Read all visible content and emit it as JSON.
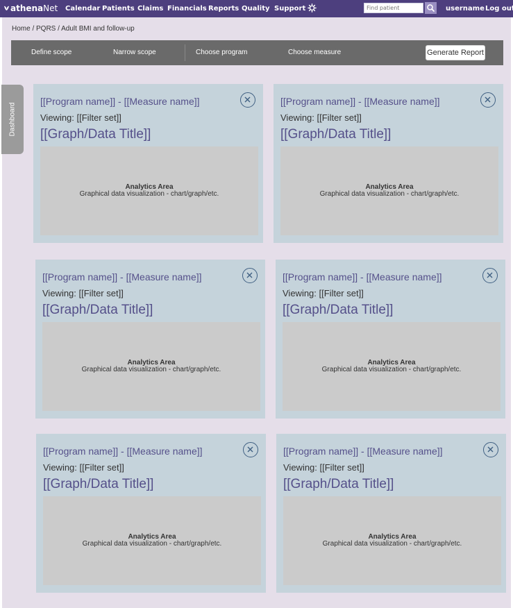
{
  "nav": {
    "logo_bold": "athena",
    "logo_light": "Net",
    "items": [
      "Calendar",
      "Patients",
      "Claims",
      "Financials",
      "Reports",
      "Quality",
      "Support"
    ],
    "search_placeholder": "Find patient",
    "username": "username",
    "logout": "Log out",
    "icons": [
      "leaf-icon",
      "gear-icon",
      "search-icon"
    ]
  },
  "breadcrumb": "Home  /  PQRS  / Adult BMI and follow-up",
  "toolbar": {
    "steps": [
      "Define scope",
      "Narrow scope",
      "Choose program",
      "Choose measure"
    ],
    "generate_label": "Generate Report"
  },
  "sidebar": {
    "dashboard_label": "Dashboard"
  },
  "cards": [
    {
      "title": "[[Program name]] - [[Measure name]]",
      "viewing": "Viewing: [[Filter set]]",
      "graph_title": "[[Graph/Data Title]]",
      "analytics_title": "Analytics Area",
      "analytics_sub": "Graphical data visualization - chart/graph/etc."
    },
    {
      "title": "[[Program name]] - [[Measure name]]",
      "viewing": "Viewing: [[Filter set]]",
      "graph_title": "[[Graph/Data Title]]",
      "analytics_title": "Analytics Area",
      "analytics_sub": "Graphical data visualization - chart/graph/etc."
    },
    {
      "title": "[[Program name]] - [[Measure name]]",
      "viewing": "Viewing: [[Filter set]]",
      "graph_title": "[[Graph/Data Title]]",
      "analytics_title": "Analytics Area",
      "analytics_sub": "Graphical data visualization - chart/graph/etc."
    },
    {
      "title": "[[Program name]] - [[Measure name]]",
      "viewing": "Viewing: [[Filter set]]",
      "graph_title": "[[Graph/Data Title]]",
      "analytics_title": "Analytics Area",
      "analytics_sub": "Graphical data visualization - chart/graph/etc."
    },
    {
      "title": "[[Program name]] - [[Measure name]]",
      "viewing": "Viewing: [[Filter set]]",
      "graph_title": "[[Graph/Data Title]]",
      "analytics_title": "Analytics Area",
      "analytics_sub": "Graphical data visualization - chart/graph/etc."
    },
    {
      "title": "[[Program name]] - [[Measure name]]",
      "viewing": "Viewing: [[Filter set]]",
      "graph_title": "[[Graph/Data Title]]",
      "analytics_title": "Analytics Area",
      "analytics_sub": "Graphical data visualization - chart/graph/etc."
    }
  ],
  "colors": {
    "nav_bg": "#4d3f7e",
    "page_bg": "#e5dee9",
    "toolbar_bg": "#6a6a6a",
    "card_bg": "#c5d3db",
    "analytics_bg": "#cbcbcb",
    "accent_text": "#55508a",
    "close_icon": "#3f5f82"
  }
}
